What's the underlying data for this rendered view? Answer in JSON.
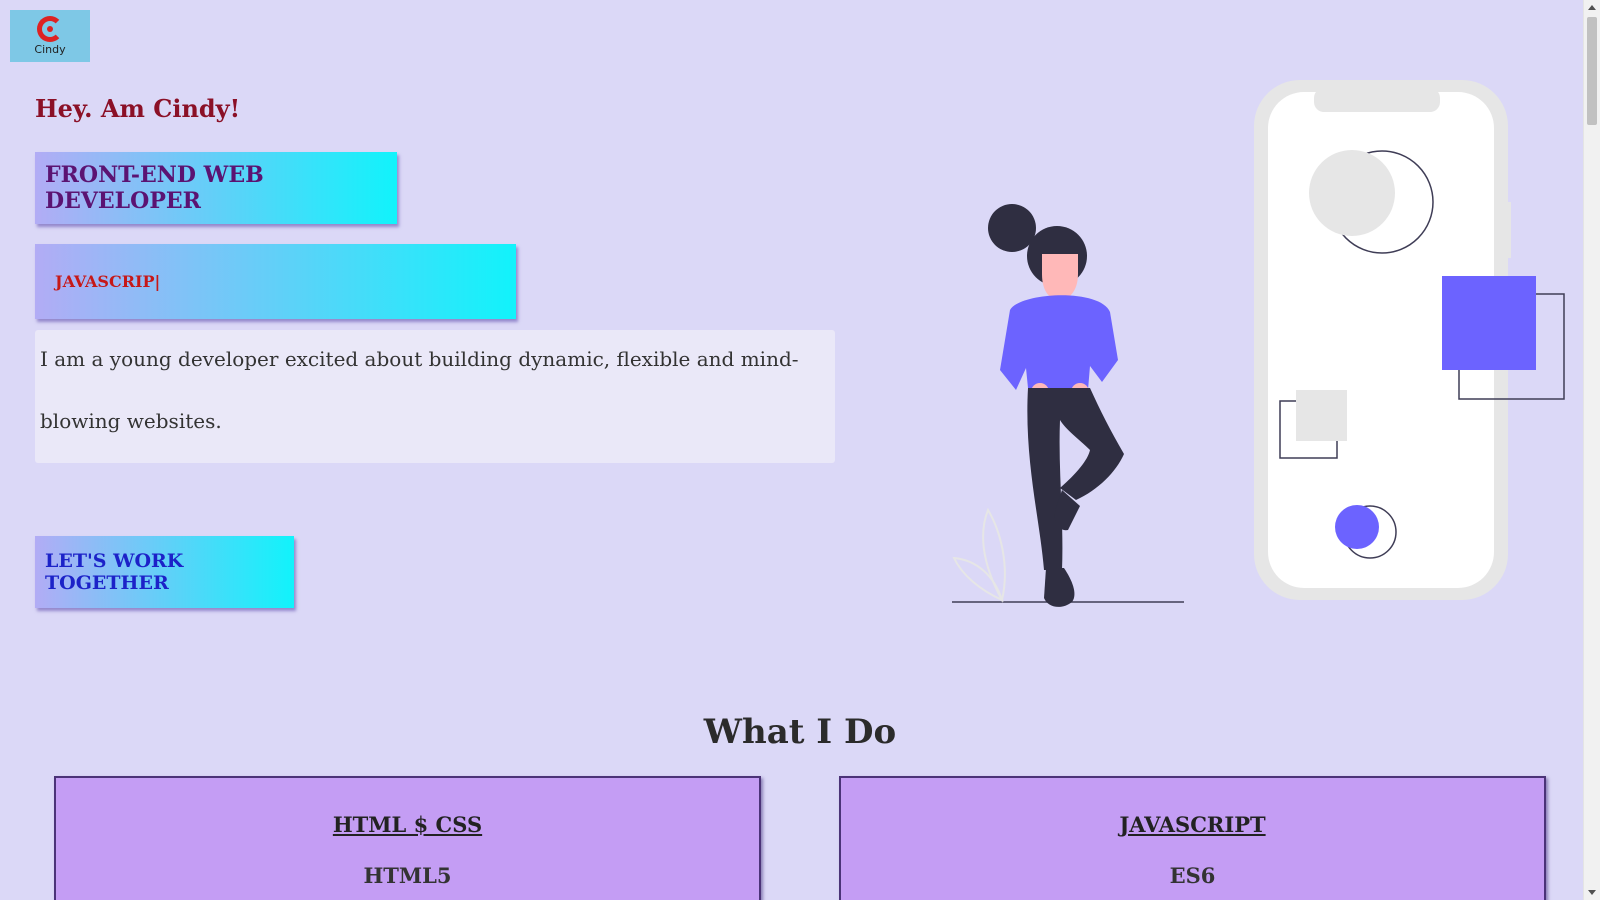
{
  "logo": {
    "text": "Cindy"
  },
  "hero": {
    "greeting": "Hey. Am Cindy!",
    "role": "FRONT-END WEB DEVELOPER",
    "typing": "JAVASCRIP|",
    "bio": "I am a young developer excited about building dynamic, flexible and mind-blowing websites.",
    "cta_label": "LET'S WORK TOGETHER"
  },
  "illustration": {
    "icon": "woman-with-phone-illustration",
    "accent": "#6c63ff"
  },
  "services": {
    "title": "What I Do",
    "cards": [
      {
        "title": "HTML $ CSS",
        "subtitle": "HTML5"
      },
      {
        "title": "JAVASCRIPT",
        "subtitle": "ES6"
      }
    ]
  },
  "colors": {
    "background": "#dbd8f7",
    "greeting": "#8b1027",
    "card": "#c49df4"
  }
}
